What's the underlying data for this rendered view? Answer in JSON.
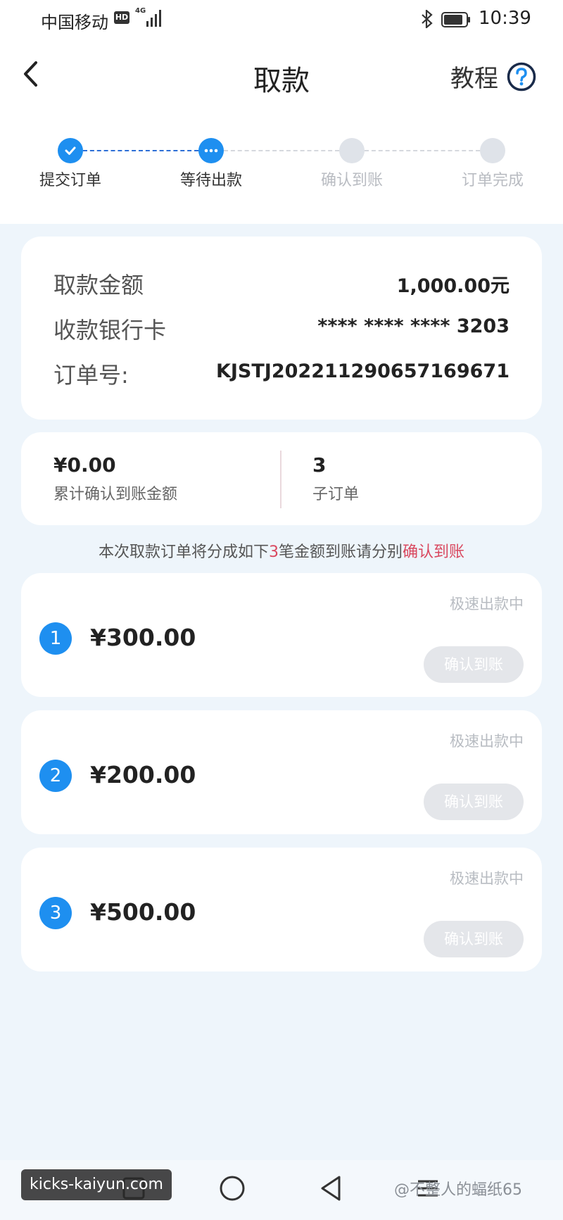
{
  "status_bar": {
    "carrier": "中国移动",
    "hd": "HD",
    "network": "4G",
    "time": "10:39"
  },
  "header": {
    "title": "取款",
    "tutorial_label": "教程"
  },
  "stepper": {
    "steps": [
      {
        "label": "提交订单",
        "state": "done"
      },
      {
        "label": "等待出款",
        "state": "current"
      },
      {
        "label": "确认到账",
        "state": "pending"
      },
      {
        "label": "订单完成",
        "state": "pending"
      }
    ]
  },
  "order_info": {
    "amount_label": "取款金额",
    "amount_value": "1,000.00元",
    "card_label": "收款银行卡",
    "card_value": "**** **** **** 3203",
    "order_no_label": "订单号:",
    "order_no_value": "KJSTJ2022112906571696­71"
  },
  "summary": {
    "confirmed_amount": "¥0.00",
    "confirmed_label": "累计确认到账金额",
    "sub_order_count": "3",
    "sub_order_label": "子订单"
  },
  "notice": {
    "prefix": "本次取款订单将分成如下",
    "count": "3",
    "middle": "笔金额到账请分别",
    "highlight": "确认到账"
  },
  "sub_orders": [
    {
      "index": "1",
      "amount": "¥300.00",
      "status": "极速出款中",
      "button": "确认到账"
    },
    {
      "index": "2",
      "amount": "¥200.00",
      "status": "极速出款中",
      "button": "确认到账"
    },
    {
      "index": "3",
      "amount": "¥500.00",
      "status": "极速出款中",
      "button": "确认到账"
    }
  ],
  "watermarks": {
    "left": "kicks-kaiyun.com",
    "right": "@不整人的蝠纸65"
  },
  "colors": {
    "accent": "#1e8ff0",
    "highlight_red": "#d9485f",
    "background": "#eef5fb"
  }
}
